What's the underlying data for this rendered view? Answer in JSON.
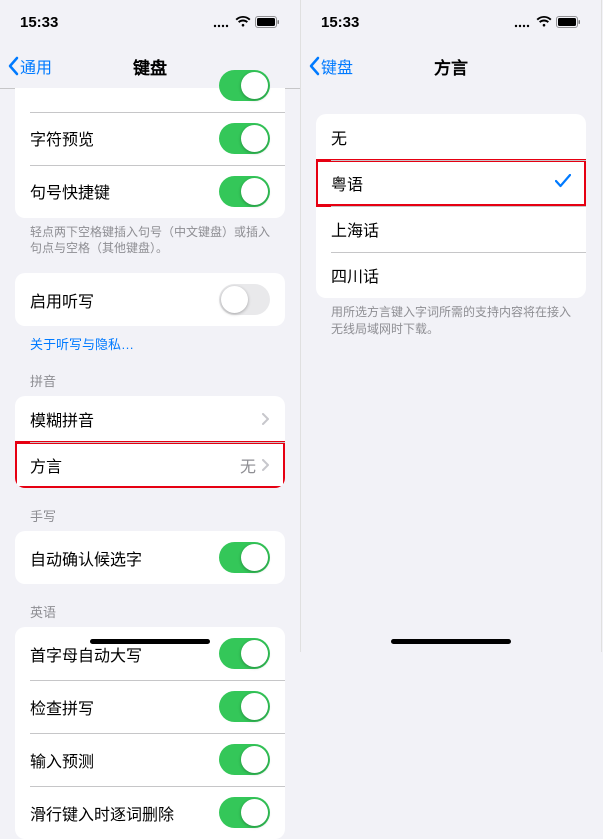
{
  "status": {
    "time": "15:33"
  },
  "left": {
    "back": "通用",
    "title": "键盘",
    "group1": {
      "rowA": {
        "label": ""
      },
      "charPreview": "字符预览",
      "periodShortcut": "句号快捷键",
      "footer": "轻点两下空格键插入句号（中文键盘）或插入句点与空格（其他键盘）。"
    },
    "dictation": {
      "enable": "启用听写",
      "privacyLink": "关于听写与隐私…"
    },
    "pinyin": {
      "header": "拼音",
      "fuzzy": "模糊拼音",
      "dialect": "方言",
      "dialectValue": "无"
    },
    "handwriting": {
      "header": "手写",
      "autoConfirm": "自动确认候选字"
    },
    "english": {
      "header": "英语",
      "autoCap": "首字母自动大写",
      "checkSpelling": "检查拼写",
      "predictive": "输入预测",
      "slideDelete": "滑行键入时逐词删除"
    }
  },
  "right": {
    "back": "键盘",
    "title": "方言",
    "options": {
      "none": "无",
      "cantonese": "粤语",
      "shanghainese": "上海话",
      "sichuanese": "四川话"
    },
    "footer": "用所选方言键入字词所需的支持内容将在接入无线局域网时下载。"
  }
}
